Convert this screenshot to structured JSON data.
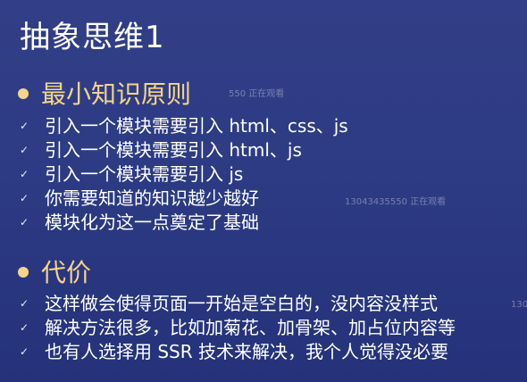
{
  "slide": {
    "title": "抽象思维1",
    "sections": [
      {
        "heading": "最小知识原则",
        "items": [
          "引入一个模块需要引入 html、css、js",
          "引入一个模块需要引入 html、js",
          "引入一个模块需要引入 js",
          "你需要知道的知识越少越好",
          "模块化为这一点奠定了基础"
        ]
      },
      {
        "heading": "代价",
        "items": [
          "这样做会使得页面一开始是空白的，没内容没样式",
          "解决方法很多，比如加菊花、加骨架、加占位内容等",
          "也有人选择用 SSR 技术来解决，我个人觉得没必要"
        ]
      }
    ],
    "watermarks": [
      "550 正在观看",
      "13043435550 正在观看",
      "130"
    ],
    "colors": {
      "background_top": "#323f87",
      "background_bottom": "#25327a",
      "heading": "#f6d489",
      "text": "#ffffff"
    },
    "icons": {
      "section_bullet": "dot-icon",
      "item_bullet": "check-icon"
    }
  }
}
